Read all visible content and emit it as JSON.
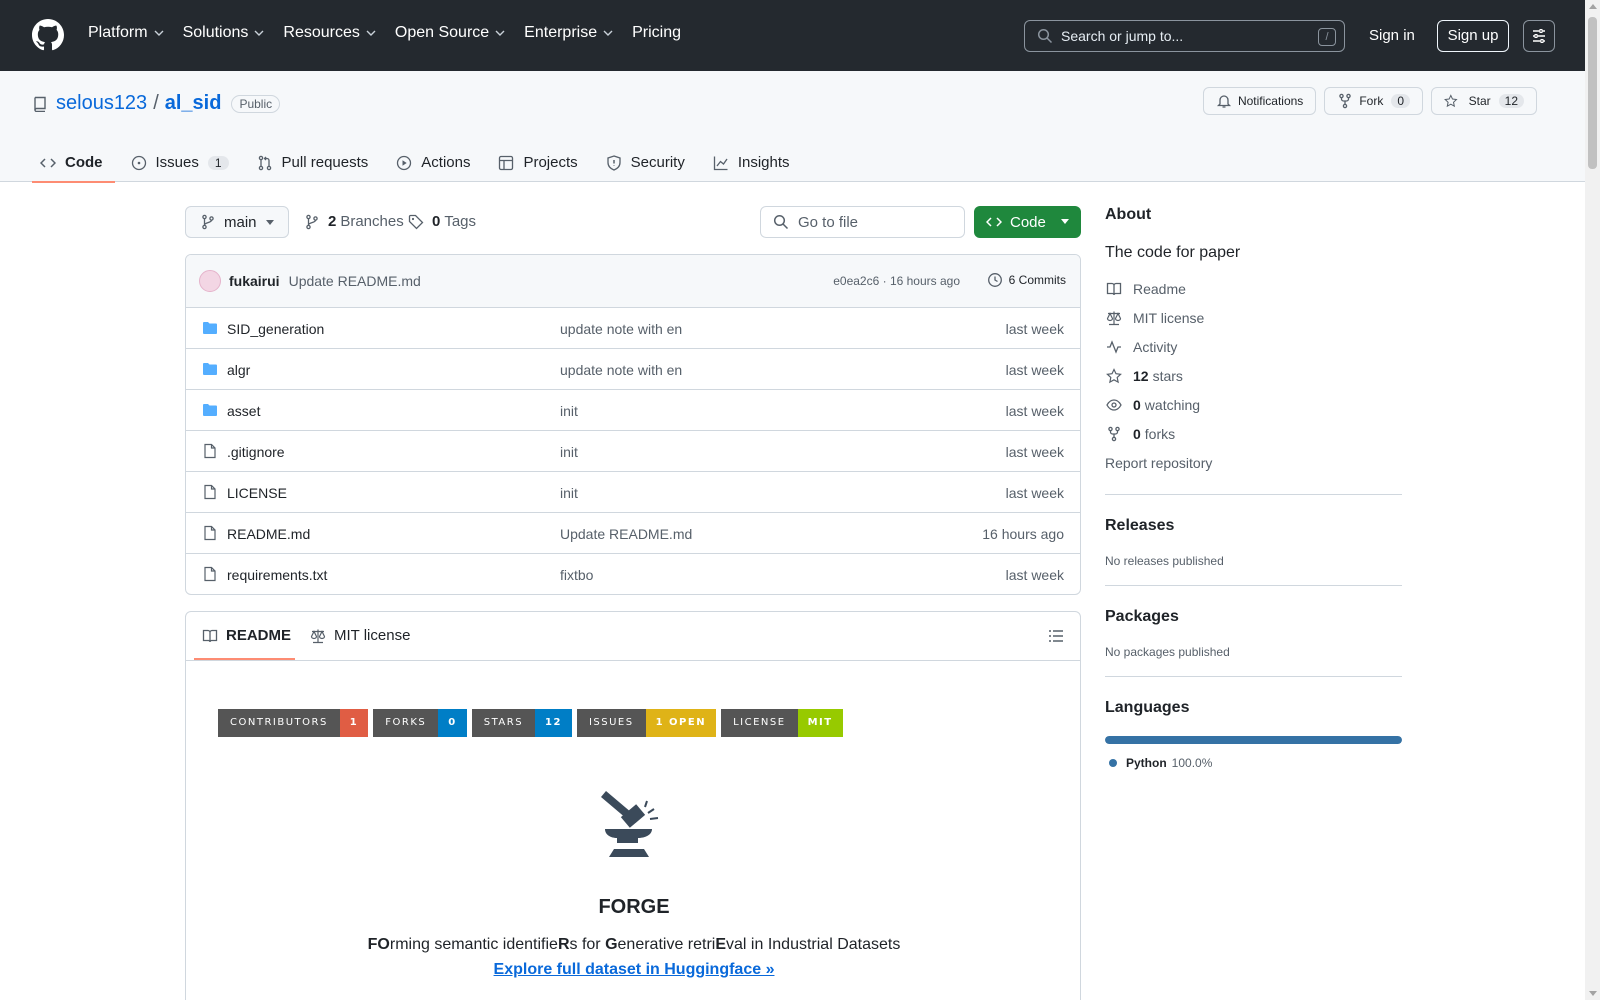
{
  "header": {
    "nav": [
      "Platform",
      "Solutions",
      "Resources",
      "Open Source",
      "Enterprise",
      "Pricing"
    ],
    "search_placeholder": "Search or jump to...",
    "search_key": "/",
    "signin": "Sign in",
    "signup": "Sign up"
  },
  "repo": {
    "owner": "selous123",
    "separator": "/",
    "name": "al_sid",
    "visibility": "Public",
    "notifications": "Notifications",
    "fork_label": "Fork",
    "fork_count": "0",
    "star_label": "Star",
    "star_count": "12"
  },
  "tabs": [
    {
      "label": "Code",
      "icon": "code-icon"
    },
    {
      "label": "Issues",
      "icon": "issue-icon",
      "count": "1"
    },
    {
      "label": "Pull requests",
      "icon": "pull-request-icon"
    },
    {
      "label": "Actions",
      "icon": "play-icon"
    },
    {
      "label": "Projects",
      "icon": "table-icon"
    },
    {
      "label": "Security",
      "icon": "shield-icon"
    },
    {
      "label": "Insights",
      "icon": "graph-icon"
    }
  ],
  "branchbar": {
    "branch": "main",
    "branches_count": "2",
    "branches_label": "Branches",
    "tags_count": "0",
    "tags_label": "Tags",
    "goto_placeholder": "Go to file",
    "code_button": "Code"
  },
  "commit": {
    "author": "fukairui",
    "message": "Update README.md",
    "meta": "e0ea2c6 · 16 hours ago",
    "commits": "6 Commits"
  },
  "files": [
    {
      "name": "SID_generation",
      "type": "folder",
      "message": "update note with en",
      "time": "last week"
    },
    {
      "name": "algr",
      "type": "folder",
      "message": "update note with en",
      "time": "last week"
    },
    {
      "name": "asset",
      "type": "folder",
      "message": "init",
      "time": "last week"
    },
    {
      "name": ".gitignore",
      "type": "file",
      "message": "init",
      "time": "last week"
    },
    {
      "name": "LICENSE",
      "type": "file",
      "message": "init",
      "time": "last week"
    },
    {
      "name": "README.md",
      "type": "file",
      "message": "Update README.md",
      "time": "16 hours ago"
    },
    {
      "name": "requirements.txt",
      "type": "file",
      "message": "fixtbo",
      "time": "last week"
    }
  ],
  "readme": {
    "tab_readme": "README",
    "tab_license": "MIT license",
    "shields": [
      {
        "label": "CONTRIBUTORS",
        "value": "1",
        "color": "#e05d44"
      },
      {
        "label": "FORKS",
        "value": "0",
        "color": "#007ec6"
      },
      {
        "label": "STARS",
        "value": "12",
        "color": "#007ec6"
      },
      {
        "label": "ISSUES",
        "value": "1 OPEN",
        "color": "#dfb317"
      },
      {
        "label": "LICENSE",
        "value": "MIT",
        "color": "#97ca00"
      }
    ],
    "title": "FORGE",
    "subtitle_parts": [
      {
        "text": "FO",
        "bold": true
      },
      {
        "text": "rming semantic identifie",
        "bold": false
      },
      {
        "text": "R",
        "bold": true
      },
      {
        "text": "s for ",
        "bold": false
      },
      {
        "text": "G",
        "bold": true
      },
      {
        "text": "enerative retri",
        "bold": false
      },
      {
        "text": "E",
        "bold": true
      },
      {
        "text": "val in Industrial Datasets",
        "bold": false
      }
    ],
    "link": "Explore full dataset in Huggingface »"
  },
  "sidebar": {
    "about_title": "About",
    "description": "The code for paper",
    "links": [
      {
        "icon": "book-icon",
        "text": "Readme"
      },
      {
        "icon": "law-icon",
        "text": "MIT license"
      },
      {
        "icon": "pulse-icon",
        "text": "Activity"
      },
      {
        "icon": "star-icon",
        "count": "12",
        "text": "stars"
      },
      {
        "icon": "eye-icon",
        "count": "0",
        "text": "watching"
      },
      {
        "icon": "fork-icon",
        "count": "0",
        "text": "forks"
      }
    ],
    "report": "Report repository",
    "releases_title": "Releases",
    "releases_text": "No releases published",
    "packages_title": "Packages",
    "packages_text": "No packages published",
    "languages_title": "Languages",
    "language": "Python",
    "language_pct": "100.0%",
    "language_share": 1.0,
    "language_color": "#3572a5"
  },
  "colors": {
    "header_bg": "#24292f",
    "link": "#0969da",
    "primary_button": "#1f883d",
    "tab_underline": "#fd8c73"
  }
}
